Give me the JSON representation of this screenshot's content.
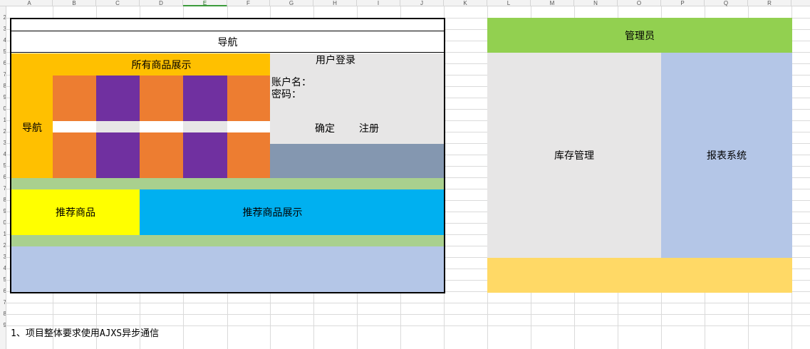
{
  "spreadsheet": {
    "columns": [
      "A",
      "B",
      "C",
      "D",
      "E",
      "F",
      "G",
      "H",
      "I",
      "J",
      "K",
      "L",
      "M",
      "N",
      "O",
      "P",
      "Q",
      "R"
    ],
    "rows": [
      "2",
      "3",
      "4",
      "5",
      "6",
      "7",
      "8",
      "9",
      "0",
      "1",
      "2",
      "3",
      "4",
      "5",
      "6",
      "7",
      "8",
      "9",
      "0",
      "1",
      "2",
      "3",
      "4",
      "5",
      "6",
      "7",
      "8",
      "9"
    ],
    "selected_column": "E"
  },
  "user_page": {
    "top_nav": "导航",
    "side_nav": "导航",
    "all_products_title": "所有商品展示",
    "login": {
      "title": "用户登录",
      "account_label": "账户名：",
      "password_label": "密码：",
      "confirm": "确定",
      "register": "注册"
    },
    "recommend_label": "推荐商品",
    "recommend_display": "推荐商品展示"
  },
  "admin_page": {
    "title": "管理员",
    "inventory": "库存管理",
    "report": "报表系统"
  },
  "note": "1、项目整体要求使用AJXS异步通信",
  "colors": {
    "orange_yellow": "#ffc000",
    "orange": "#ed7d31",
    "purple": "#7030a0",
    "gray_light": "#e7e6e6",
    "slate": "#8497b0",
    "green_light": "#a9d08e",
    "yellow": "#ffff00",
    "cyan": "#00b0f0",
    "blue_light": "#b4c6e7",
    "green": "#92d050",
    "gold_light": "#ffd966"
  }
}
